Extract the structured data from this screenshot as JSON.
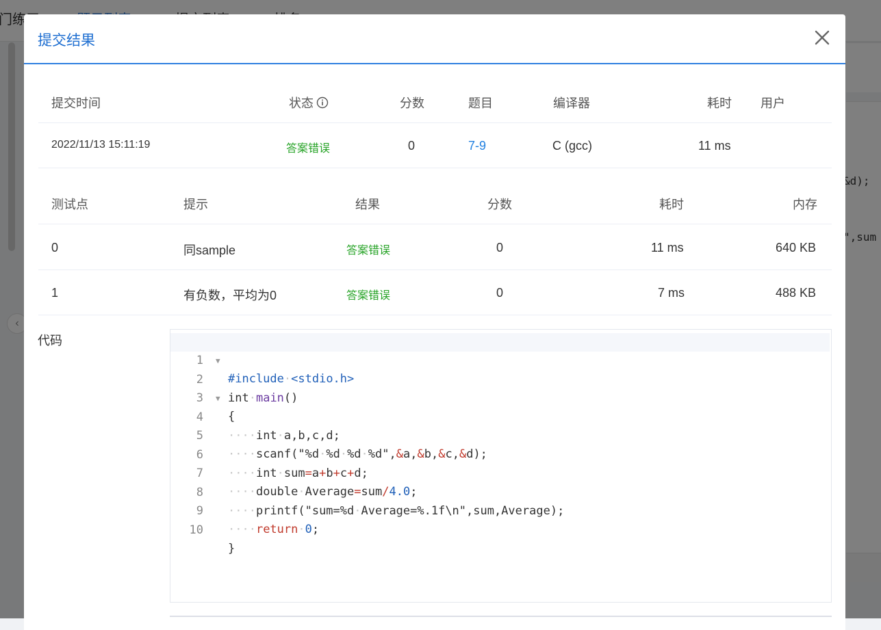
{
  "background": {
    "nav_items": [
      "门练习",
      "题目列表",
      "提交列表",
      "排名"
    ],
    "code_fragments": [
      "&d);",
      "\",sum"
    ]
  },
  "modal": {
    "title": "提交结果",
    "close_icon": "close-icon"
  },
  "submission": {
    "headers": {
      "time": "提交时间",
      "status": "状态",
      "score": "分数",
      "problem": "题目",
      "compiler": "编译器",
      "elapsed": "耗时",
      "user": "用户"
    },
    "row": {
      "time": "2022/11/13 15:11:19",
      "status": "答案错误",
      "score": "0",
      "problem": "7-9",
      "compiler": "C (gcc)",
      "elapsed": "11 ms",
      "user": ""
    }
  },
  "testcases": {
    "headers": {
      "id": "测试点",
      "hint": "提示",
      "result": "结果",
      "score": "分数",
      "elapsed": "耗时",
      "memory": "内存"
    },
    "rows": [
      {
        "id": "0",
        "hint": "同sample",
        "result": "答案错误",
        "score": "0",
        "elapsed": "11 ms",
        "memory": "640 KB"
      },
      {
        "id": "1",
        "hint": "有负数，平均为0",
        "result": "答案错误",
        "score": "0",
        "elapsed": "7 ms",
        "memory": "488 KB"
      }
    ]
  },
  "code": {
    "label": "代码",
    "lines": [
      "#include <stdio.h>",
      "int main()",
      "{",
      "    int a,b,c,d;",
      "    scanf(\"%d %d %d %d\",&a,&b,&c,&d);",
      "    int sum=a+b+c+d;",
      "    double Average=sum/4.0;",
      "    printf(\"sum=%d Average=%.1f\\n\",sum,Average);",
      "    return 0;",
      "}"
    ]
  },
  "colors": {
    "accent": "#1f6fd1",
    "wrong_answer": "#26a326",
    "link": "#1f7fe0"
  }
}
